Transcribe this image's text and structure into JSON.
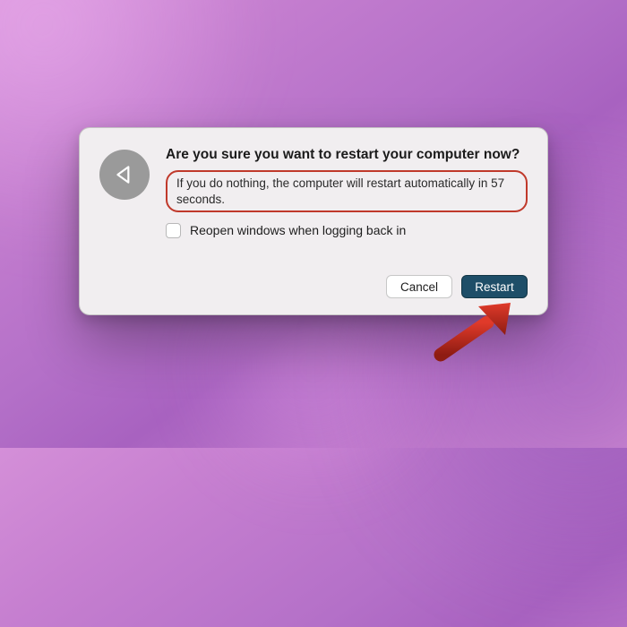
{
  "dialog": {
    "title": "Are you sure you want to restart your computer now?",
    "message": "If you do nothing, the computer will restart automatically in 57 seconds.",
    "checkbox_label": "Reopen windows when logging back in",
    "cancel_label": "Cancel",
    "confirm_label": "Restart",
    "icon_name": "restart-icon"
  },
  "colors": {
    "annotation": "#c0392b",
    "primary_button": "#1e4e68"
  }
}
